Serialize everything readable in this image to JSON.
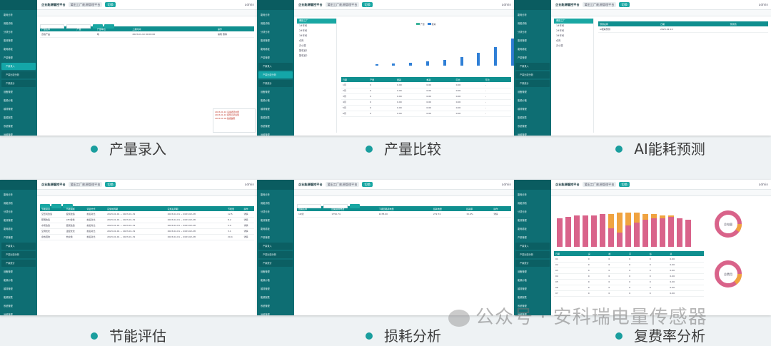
{
  "platform_title": "企业能源管控平台",
  "captions": [
    "产量录入",
    "产量比较",
    "AI能耗预测",
    "节能评估",
    "损耗分析",
    "复费率分析"
  ],
  "watermark": "公众号 · 安科瑞电量传感器",
  "colors": {
    "sidebar": "#0e6e73",
    "accent": "#19a7a3",
    "header": "#0f8f8f",
    "bar_blue": "#2f7fd6",
    "bar_pink": "#d9638a",
    "bar_orange": "#f0a340",
    "bar_green": "#3bb39a",
    "dot": "#1a9e9e"
  },
  "sidebar": [
    "能耗分析",
    "用能诊断",
    "分项分析",
    "能效管理",
    "能耗看板",
    "产量管理",
    "产量录入",
    "产量比较分析",
    "产量统计",
    "设备管理",
    "能源价格",
    "碳排管理",
    "能源报表",
    "系统管理",
    "运维管理",
    "能效预警",
    "节能评估"
  ],
  "topbar": {
    "select": "莆田工厂能源管理平台",
    "btn": "切换",
    "right": "admin"
  },
  "tabs": [
    "首页",
    "能耗概览",
    "产量录入",
    "产量比较",
    "能耗报表",
    "AI能耗预测",
    "节能评估"
  ],
  "shot1": {
    "headers": [
      "产量名称",
      "产量",
      "产量单位",
      "上报时间",
      "操作"
    ],
    "rows": [
      [
        "合格产品",
        "",
        "吨",
        "2023-01-10 00:00:00",
        "编辑 删除"
      ]
    ]
  },
  "shot2": {
    "tree": [
      "莆田工厂",
      "1#车间",
      "2#车间",
      "3#车间",
      "仓库",
      "办公楼",
      "配电室1",
      "配电室2"
    ],
    "legend": [
      "产量",
      "能耗"
    ],
    "headers": [
      "日期",
      "产量",
      "能耗",
      "单耗",
      "同比",
      "环比"
    ],
    "rows": [
      [
        "1月",
        "0",
        "0.00",
        "0.00",
        "0.00",
        "-"
      ],
      [
        "2月",
        "0",
        "0.00",
        "0.00",
        "0.00",
        "-"
      ],
      [
        "3月",
        "0",
        "0.00",
        "0.00",
        "0.00",
        "-"
      ],
      [
        "4月",
        "0",
        "0.00",
        "0.00",
        "0.00",
        "-"
      ],
      [
        "5月",
        "0",
        "0.00",
        "0.00",
        "0.00",
        "-"
      ],
      [
        "6月",
        "0",
        "0.00",
        "0.00",
        "0.00",
        "-"
      ]
    ],
    "logs": [
      "2023-01-10 设备通讯中断",
      "2023-01-10 报警记录提醒",
      "2023-01-09 数据越限"
    ]
  },
  "shot3": {
    "tree": [
      "莆田工厂",
      "1#车间",
      "2#车间",
      "3#车间",
      "仓库",
      "办公楼"
    ],
    "headers": [
      "预测名称",
      "日期",
      "预测值"
    ],
    "rows": [
      [
        "AI能耗预测",
        "2023-01-10",
        ""
      ]
    ]
  },
  "shot4": {
    "headers": [
      "节能项目",
      "节能措施",
      "评估方式",
      "实施前周期",
      "实施后周期",
      "节能量",
      "操作"
    ],
    "rows": [
      [
        "空压机改造",
        "变频改造",
        "前后对比",
        "2023-01-01 ~ 2023-01-31",
        "2023-02-01 ~ 2023-02-28",
        "12.5",
        "详情"
      ],
      [
        "照明改造",
        "LED替换",
        "前后对比",
        "2023-01-01 ~ 2023-01-31",
        "2023-02-01 ~ 2023-02-28",
        "8.2",
        "详情"
      ],
      [
        "水泵改造",
        "变频改造",
        "前后对比",
        "2023-01-01 ~ 2023-01-31",
        "2023-02-01 ~ 2023-02-28",
        "5.0",
        "详情"
      ],
      [
        "空调优化",
        "温控优化",
        "前后对比",
        "2023-01-01 ~ 2023-01-31",
        "2023-02-01 ~ 2023-02-28",
        "3.1",
        "详情"
      ],
      [
        "余热回收",
        "热交换",
        "前后对比",
        "2023-01-01 ~ 2023-01-31",
        "2023-02-01 ~ 2023-02-28",
        "20.4",
        "详情"
      ]
    ]
  },
  "shot5": {
    "headers": [
      "回路名称",
      "回路总用电量",
      "下级回路用电量",
      "损耗电量",
      "损耗率",
      "操作"
    ],
    "rows": [
      [
        "1#线",
        "1750.74",
        "1478.00",
        "272.74",
        "15.6%",
        "详情"
      ]
    ]
  },
  "shot6": {
    "headers": [
      "日期",
      "尖",
      "峰",
      "平",
      "谷",
      "总"
    ],
    "rows": [
      [
        "01",
        "0",
        "0",
        "0",
        "0",
        "0.00"
      ],
      [
        "02",
        "0",
        "0",
        "0",
        "0",
        "0.00"
      ],
      [
        "03",
        "0",
        "0",
        "0",
        "0",
        "0.00"
      ],
      [
        "04",
        "0",
        "0",
        "0",
        "0",
        "0.00"
      ],
      [
        "05",
        "0",
        "0",
        "0",
        "0",
        "0.00"
      ],
      [
        "06",
        "0",
        "0",
        "0",
        "0",
        "0.00"
      ],
      [
        "07",
        "0",
        "0",
        "0",
        "0",
        "0.00"
      ]
    ],
    "donut1": "总电量",
    "donut2": "总费用"
  }
}
